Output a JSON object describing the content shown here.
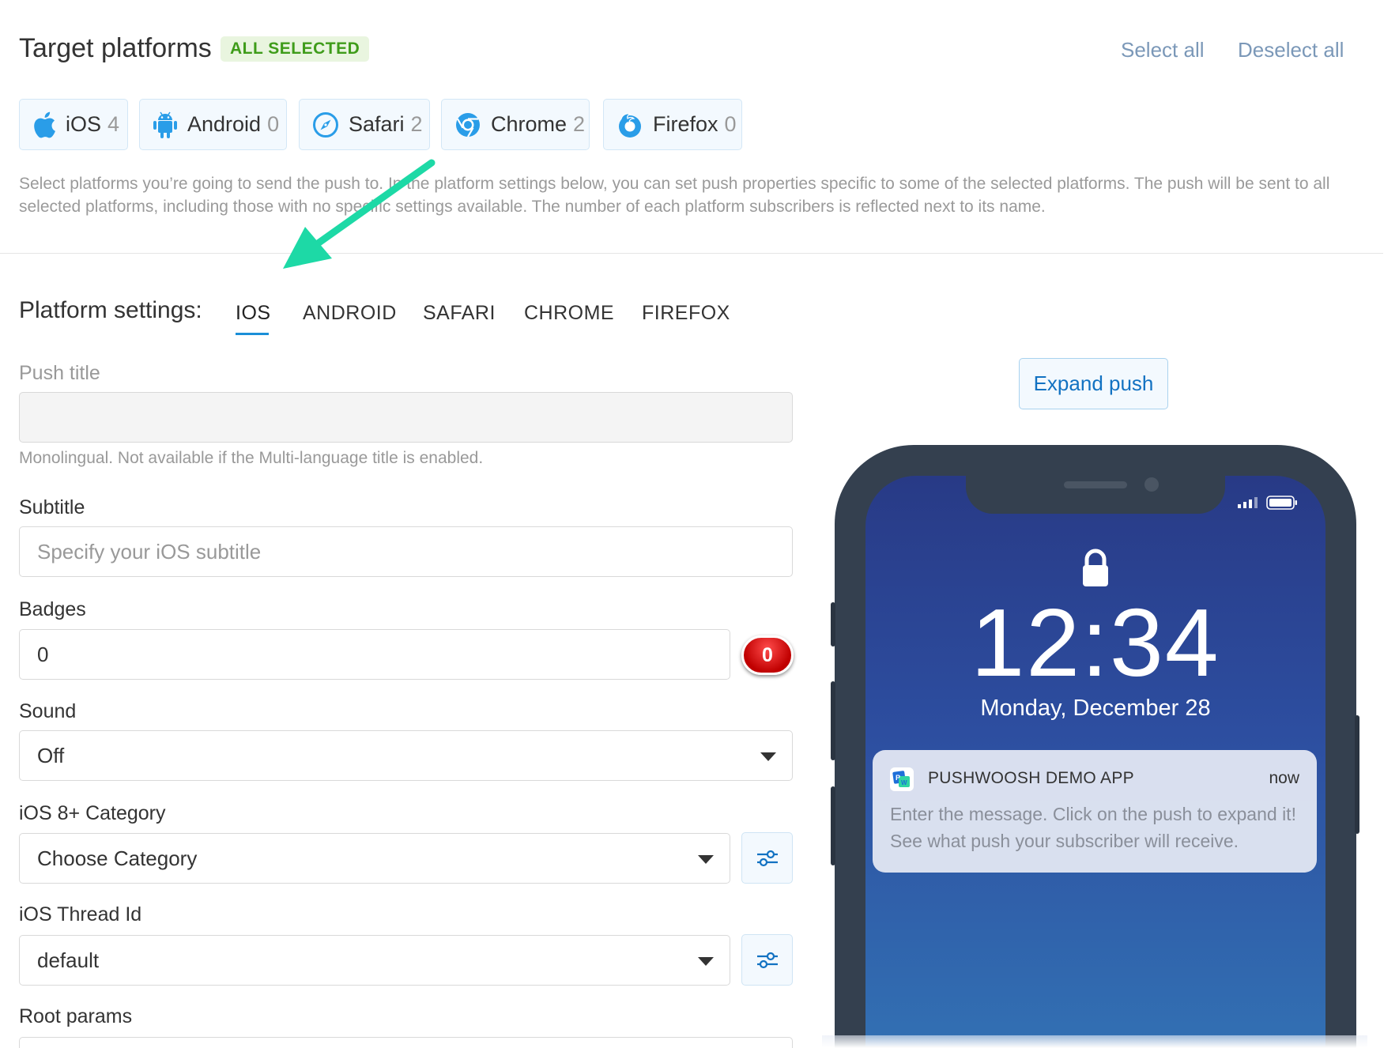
{
  "header": {
    "title": "Target platforms",
    "badge": "ALL SELECTED",
    "select_all": "Select all",
    "deselect_all": "Deselect all"
  },
  "platforms": [
    {
      "name": "iOS",
      "count": "4",
      "icon": "apple-icon"
    },
    {
      "name": "Android",
      "count": "0",
      "icon": "android-icon"
    },
    {
      "name": "Safari",
      "count": "2",
      "icon": "safari-icon"
    },
    {
      "name": "Chrome",
      "count": "2",
      "icon": "chrome-icon"
    },
    {
      "name": "Firefox",
      "count": "0",
      "icon": "firefox-icon"
    }
  ],
  "description": "Select platforms you’re going to send the push to. In the platform settings below, you can set push properties specific to some of the selected platforms. The push will be sent to all selected platforms, including those with no specific settings available. The number of each platform subscribers is reflected next to its name.",
  "settings": {
    "label": "Platform settings:",
    "tabs": [
      "IOS",
      "ANDROID",
      "SAFARI",
      "CHROME",
      "FIREFOX"
    ],
    "active_tab": "IOS"
  },
  "form": {
    "push_title_label": "Push title",
    "push_title_value": "",
    "push_title_hint": "Monolingual. Not available if the Multi-language title is enabled.",
    "subtitle_label": "Subtitle",
    "subtitle_placeholder": "Specify your iOS subtitle",
    "badges_label": "Badges",
    "badges_value": "0",
    "badge_preview": "0",
    "sound_label": "Sound",
    "sound_value": "Off",
    "category_label": "iOS 8+ Category",
    "category_value": "Choose Category",
    "thread_label": "iOS Thread Id",
    "thread_value": "default",
    "root_label": "Root params"
  },
  "preview": {
    "expand_button": "Expand push",
    "time": "12:34",
    "date": "Monday, December 28",
    "notification": {
      "app_name": "PUSHWOOSH DEMO APP",
      "time": "now",
      "message": "Enter the message. Click on the push to expand it! See what push your subscriber will receive."
    }
  },
  "colors": {
    "accent": "#1a8fd8",
    "badge_green": "#3f9c1a",
    "arrow": "#1dd9a6",
    "screen_top": "#283a86",
    "screen_bottom": "#3270b3"
  }
}
